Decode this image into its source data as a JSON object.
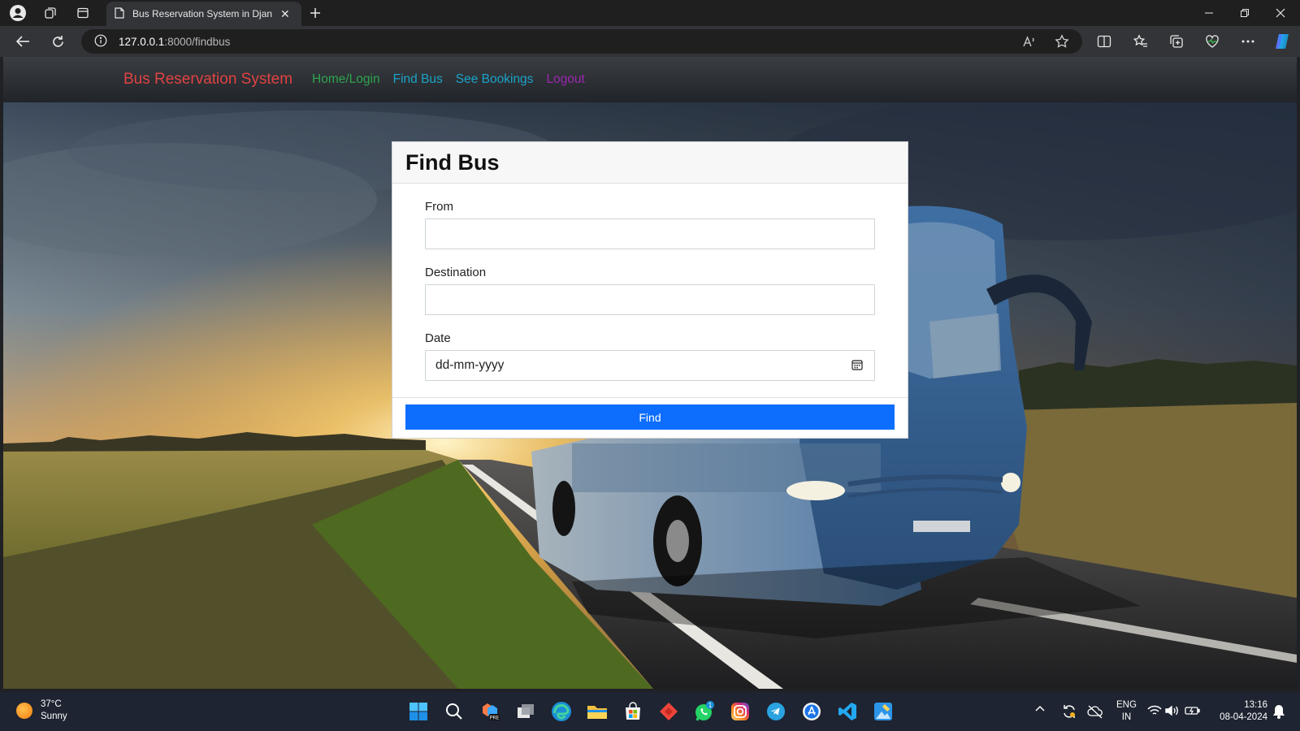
{
  "browser": {
    "tab_title": "Bus Reservation System in Djang",
    "url_host": "127.0.0.1",
    "url_path": ":8000/findbus"
  },
  "navbar": {
    "brand": "Bus Reservation System",
    "links": [
      {
        "label": "Home/Login",
        "color": "#2ea44f"
      },
      {
        "label": "Find Bus",
        "color": "#1aa3c8"
      },
      {
        "label": "See Bookings",
        "color": "#1aa3c8"
      },
      {
        "label": "Logout",
        "color": "#9b27af"
      }
    ]
  },
  "form": {
    "title": "Find Bus",
    "from_label": "From",
    "from_value": "",
    "destination_label": "Destination",
    "destination_value": "",
    "date_label": "Date",
    "date_placeholder": "dd-mm-yyyy",
    "submit_label": "Find"
  },
  "taskbar": {
    "temperature": "37°C",
    "weather": "Sunny",
    "language": "ENG",
    "region": "IN",
    "time": "13:16",
    "date": "08-04-2024",
    "whatsapp_badge": "1"
  }
}
